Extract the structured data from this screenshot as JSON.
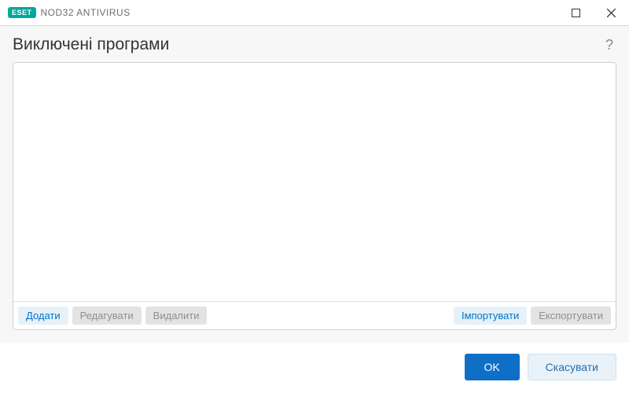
{
  "titlebar": {
    "brand_badge": "ESET",
    "brand_text": "NOD32 ANTIVIRUS"
  },
  "header": {
    "title": "Виключені програми",
    "help_symbol": "?"
  },
  "toolbar": {
    "add": "Додати",
    "edit": "Редагувати",
    "delete": "Видалити",
    "import": "Імпортувати",
    "export": "Експортувати"
  },
  "footer": {
    "ok": "OK",
    "cancel": "Скасувати"
  }
}
